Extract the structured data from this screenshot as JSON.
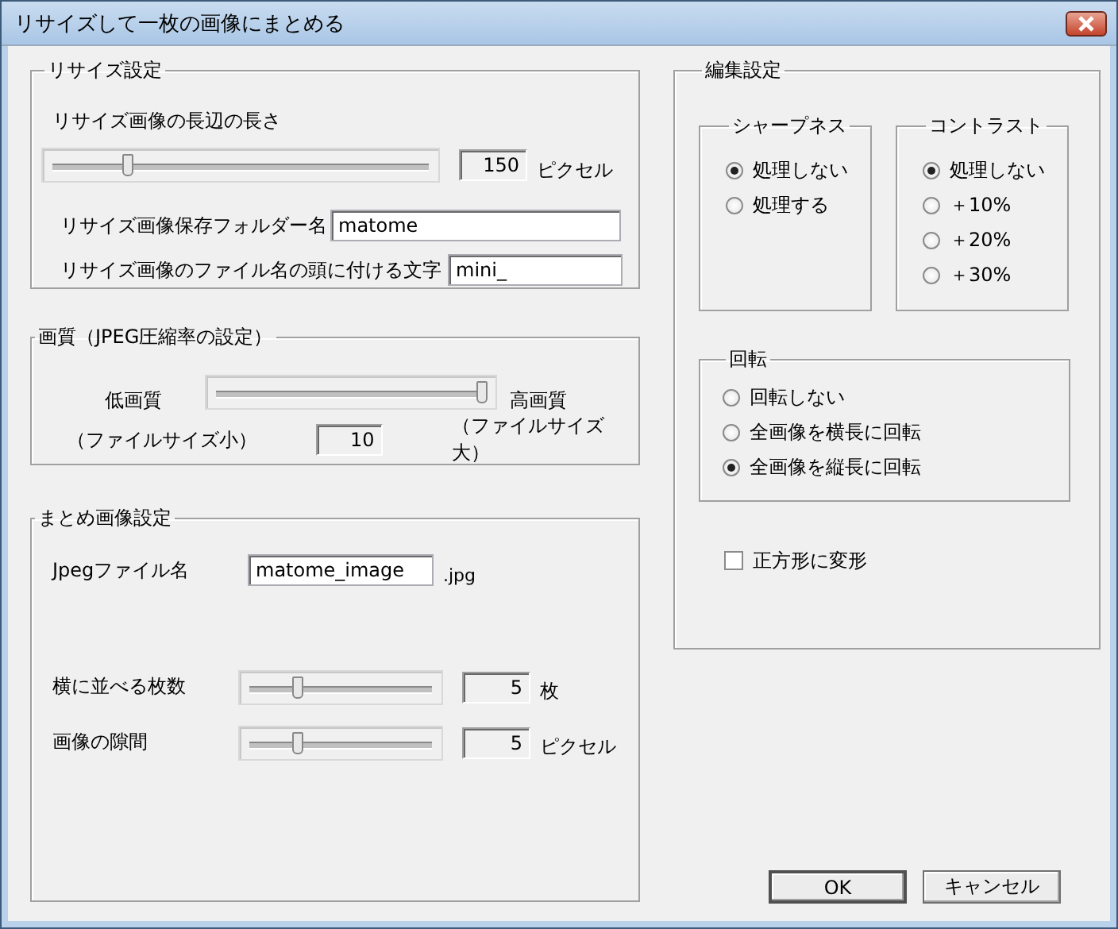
{
  "window": {
    "title": "リサイズして一枚の画像にまとめる"
  },
  "resize": {
    "title": "リサイズ設定",
    "length_label": "リサイズ画像の長辺の長さ",
    "level": 0.19,
    "value": "150",
    "unit": "ピクセル",
    "folder_label": "リサイズ画像保存フォルダー名",
    "folder_value": "matome",
    "prefix_label": "リサイズ画像のファイル名の頭に付ける文字",
    "prefix_value": "mini_"
  },
  "quality": {
    "title": "画質（JPEG圧縮率の設定）",
    "low_label": "低画質",
    "high_label": "高画質",
    "low_note": "（ファイルサイズ小）",
    "high_note": "（ファイルサイズ大）",
    "level": 1,
    "value": "10"
  },
  "combine": {
    "title": "まとめ画像設定",
    "filename_label": "Jpegファイル名",
    "filename_value": "matome_image",
    "extension": ".jpg",
    "sliders": [
      {
        "label": "横に並べる枚数",
        "level": 0.25,
        "value": "5",
        "unit": "枚"
      },
      {
        "label": "画像の隙間",
        "level": 0.25,
        "value": "5",
        "unit": "ピクセル"
      }
    ]
  },
  "edit": {
    "title": "編集設定",
    "sharpness": {
      "title": "シャープネス",
      "options": [
        {
          "label": "処理しない",
          "selected": true
        },
        {
          "label": "処理する",
          "selected": false
        }
      ]
    },
    "contrast": {
      "title": "コントラスト",
      "options": [
        {
          "label": "処理しない",
          "selected": true
        },
        {
          "label": "＋10%",
          "selected": false
        },
        {
          "label": "＋20%",
          "selected": false
        },
        {
          "label": "＋30%",
          "selected": false
        }
      ]
    },
    "rotation": {
      "title": "回転",
      "options": [
        {
          "label": "回転しない",
          "selected": false
        },
        {
          "label": "全画像を横長に回転",
          "selected": false
        },
        {
          "label": "全画像を縦長に回転",
          "selected": true
        }
      ]
    },
    "square": {
      "label": "正方形に変形",
      "checked": false
    }
  },
  "buttons": [
    "OK",
    "キャンセル"
  ]
}
